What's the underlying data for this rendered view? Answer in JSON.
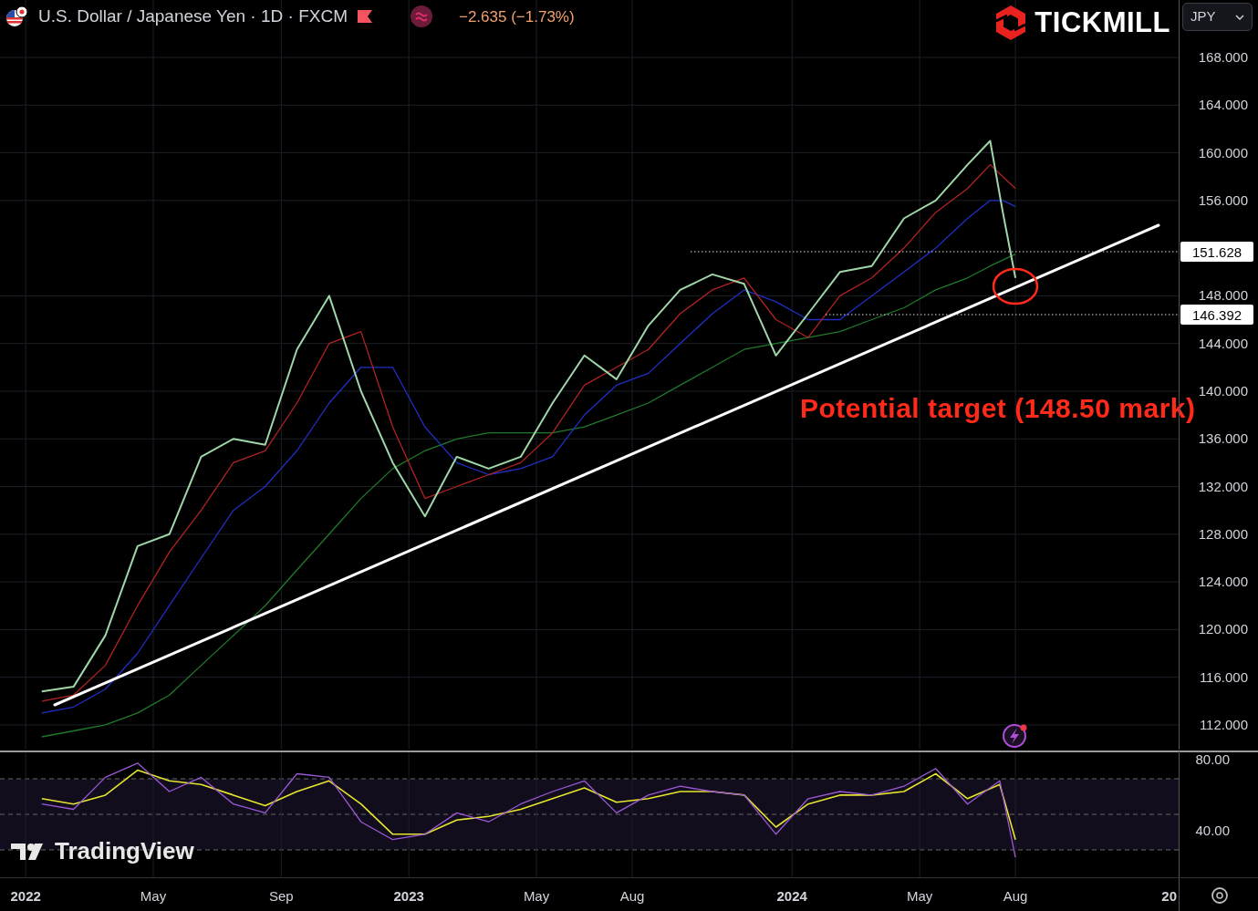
{
  "header": {
    "symbol": "U.S. Dollar / Japanese Yen · 1D · FXCM",
    "change": "−2.635 (−1.73%)"
  },
  "logo": {
    "text": "TICKMILL"
  },
  "currency_select": {
    "value": "JPY"
  },
  "price_chart": {
    "chart_data": {
      "type": "line",
      "xlim": [
        2021.933,
        2025.216
      ],
      "ylim": [
        109.93,
        172.82
      ],
      "yticks": [
        {
          "value": 112,
          "label": "112.000"
        },
        {
          "value": 116,
          "label": "116.000"
        },
        {
          "value": 120,
          "label": "120.000"
        },
        {
          "value": 124,
          "label": "124.000"
        },
        {
          "value": 128,
          "label": "128.000"
        },
        {
          "value": 132,
          "label": "132.000"
        },
        {
          "value": 136,
          "label": "136.000"
        },
        {
          "value": 140,
          "label": "140.000"
        },
        {
          "value": 144,
          "label": "144.000"
        },
        {
          "value": 148,
          "label": "148.000"
        },
        {
          "value": 156,
          "label": "156.000"
        },
        {
          "value": 160,
          "label": "160.000"
        },
        {
          "value": 164,
          "label": "164.000"
        },
        {
          "value": 168,
          "label": "168.000"
        }
      ],
      "x": [
        2022.042,
        2022.125,
        2022.208,
        2022.292,
        2022.375,
        2022.458,
        2022.542,
        2022.625,
        2022.708,
        2022.792,
        2022.875,
        2022.958,
        2023.042,
        2023.125,
        2023.208,
        2023.292,
        2023.375,
        2023.458,
        2023.542,
        2023.625,
        2023.708,
        2023.792,
        2023.875,
        2023.958,
        2024.042,
        2024.125,
        2024.208,
        2024.292,
        2024.375,
        2024.458,
        2024.517,
        2024.55,
        2024.583
      ],
      "series": [
        {
          "color": "#9fd7a8",
          "values": [
            114.8,
            115.2,
            119.5,
            127,
            128,
            134.5,
            136,
            135.5,
            143.5,
            148,
            140,
            134,
            129.5,
            134.5,
            133.5,
            134.5,
            139,
            143,
            141,
            145.5,
            148.5,
            149.8,
            149,
            143,
            146.5,
            150,
            150.5,
            154.5,
            156,
            159,
            161,
            155,
            149.5
          ]
        },
        {
          "color": "#b22222",
          "values": [
            114,
            114.5,
            117,
            122,
            126.5,
            130,
            134,
            135,
            139,
            144,
            145,
            137,
            131,
            132,
            133,
            134,
            136.5,
            140.5,
            142,
            143.5,
            146.5,
            148.5,
            149.5,
            146,
            144.5,
            148,
            149.5,
            152,
            155,
            157,
            159,
            158,
            157
          ]
        },
        {
          "color": "#1f2fc4",
          "values": [
            113,
            113.5,
            115,
            118,
            122,
            126,
            130,
            132,
            135,
            139,
            142,
            142,
            137,
            134,
            133,
            133.5,
            134.5,
            138,
            140.5,
            141.5,
            144,
            146.5,
            148.5,
            147.5,
            146,
            146,
            148,
            150,
            152,
            154.5,
            156,
            156,
            155.5
          ]
        },
        {
          "color": "#1f7a2a",
          "values": [
            111,
            111.5,
            112,
            113,
            114.5,
            117,
            119.5,
            122,
            125,
            128,
            131,
            133.5,
            135,
            136,
            136.5,
            136.5,
            136.5,
            137,
            138,
            139,
            140.5,
            142,
            143.5,
            144,
            144.5,
            145,
            146,
            147,
            148.5,
            149.5,
            150.5,
            151,
            151.5
          ]
        }
      ],
      "grid": true,
      "annotations": [
        "Potential target (148.50 mark)"
      ]
    }
  },
  "rsi_chart": {
    "chart_data": {
      "type": "line",
      "xlim": [
        2021.933,
        2025.216
      ],
      "ylim": [
        13.8,
        85.6
      ],
      "yticks": [
        {
          "value": 80,
          "label": "80.00"
        },
        {
          "value": 40,
          "label": "40.00"
        }
      ],
      "xticks": [
        {
          "value": 2022,
          "label": "2022"
        },
        {
          "value": 2022.333,
          "label": "May"
        },
        {
          "value": 2022.667,
          "label": "Sep"
        },
        {
          "value": 2023,
          "label": "2023"
        },
        {
          "value": 2023.333,
          "label": "May"
        },
        {
          "value": 2023.583,
          "label": "Aug"
        },
        {
          "value": 2024,
          "label": "2024"
        },
        {
          "value": 2024.333,
          "label": "May"
        },
        {
          "value": 2024.583,
          "label": "Aug"
        }
      ],
      "grid": true,
      "x": [
        2022.042,
        2022.125,
        2022.208,
        2022.292,
        2022.375,
        2022.458,
        2022.542,
        2022.625,
        2022.708,
        2022.792,
        2022.875,
        2022.958,
        2023.042,
        2023.125,
        2023.208,
        2023.292,
        2023.375,
        2023.458,
        2023.542,
        2023.625,
        2023.708,
        2023.792,
        2023.875,
        2023.958,
        2024.042,
        2024.125,
        2024.208,
        2024.292,
        2024.375,
        2024.458,
        2024.542,
        2024.583
      ],
      "series": [
        {
          "color": "#9b59d6",
          "values": [
            55,
            52,
            70,
            78,
            62,
            70,
            55,
            50,
            72,
            70,
            45,
            35,
            38,
            50,
            45,
            55,
            62,
            68,
            50,
            60,
            65,
            62,
            60,
            38,
            58,
            62,
            60,
            65,
            75,
            55,
            68,
            25
          ]
        },
        {
          "color": "#e6e62e",
          "values": [
            58,
            55,
            60,
            74,
            68,
            66,
            60,
            54,
            62,
            68,
            55,
            38,
            38,
            46,
            48,
            52,
            58,
            64,
            56,
            58,
            62,
            62,
            60,
            42,
            55,
            60,
            60,
            62,
            72,
            58,
            66,
            35
          ]
        }
      ]
    }
  },
  "price_labels": [
    "151.628",
    "146.392"
  ],
  "time_axis": {
    "cut_label": "20"
  },
  "watermark": {
    "text": "TradingView"
  }
}
